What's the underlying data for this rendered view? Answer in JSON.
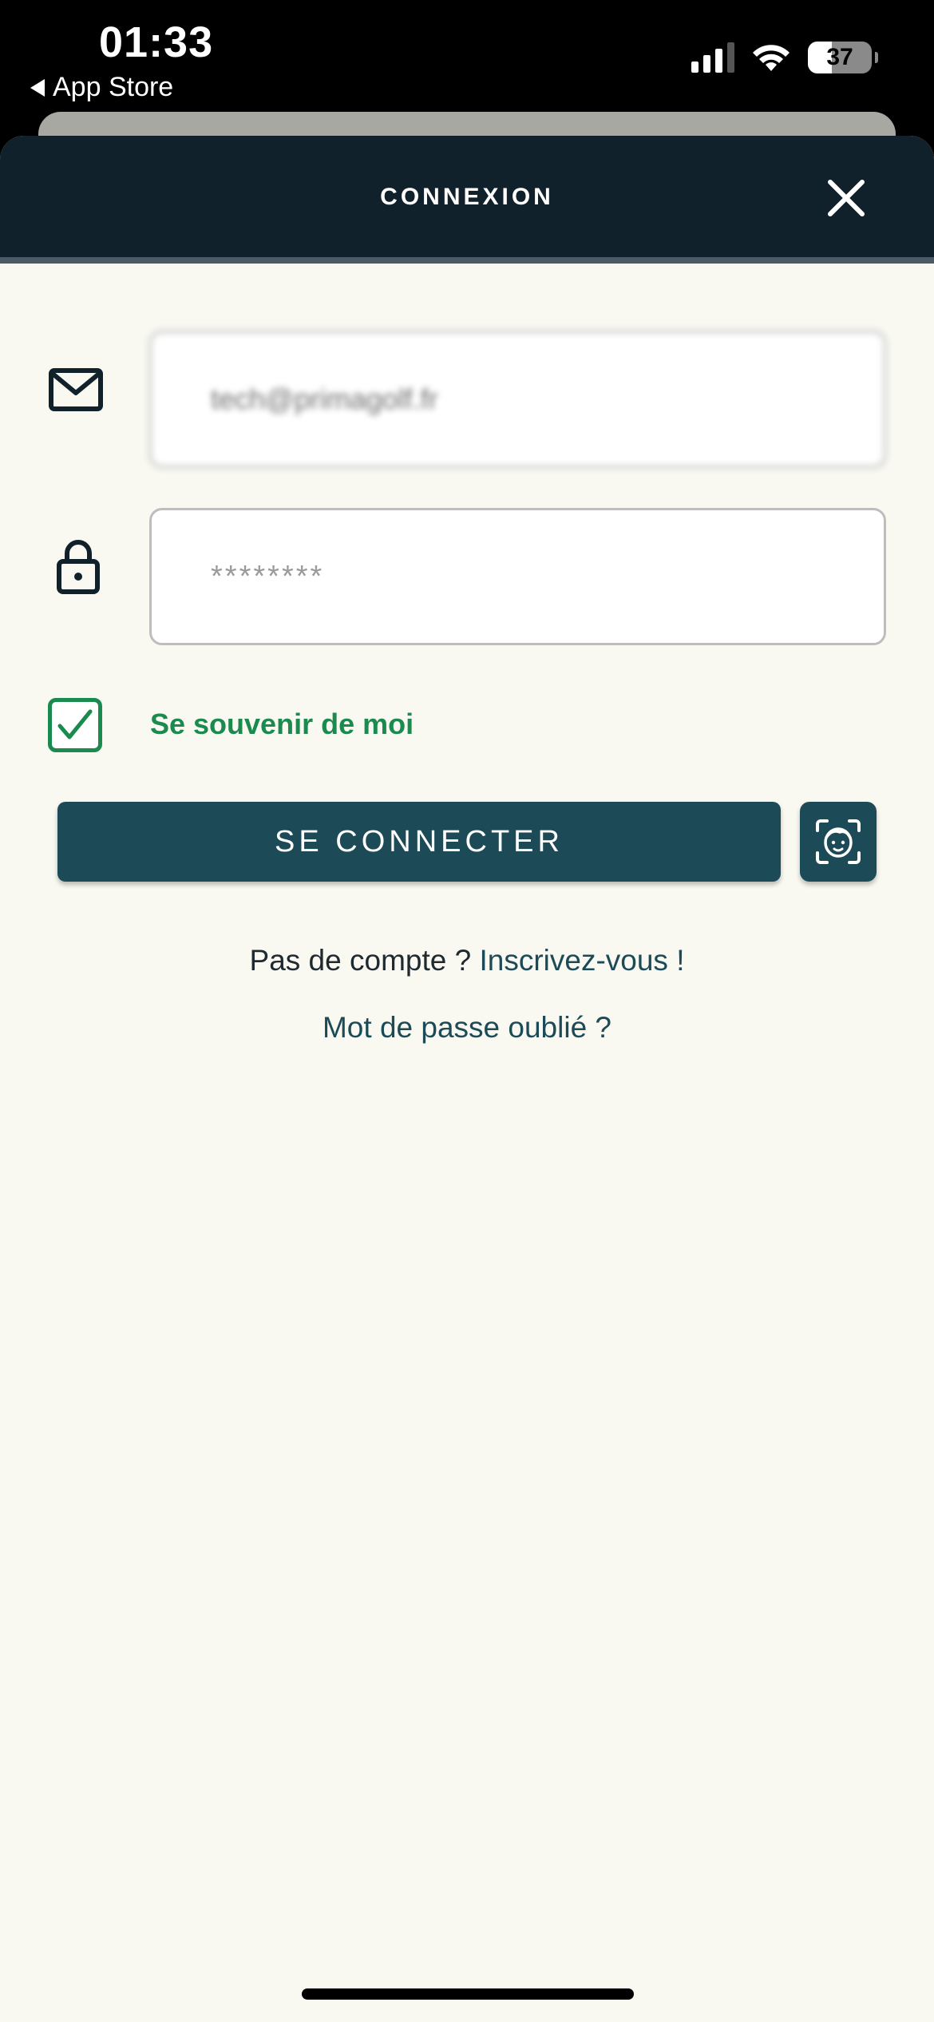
{
  "status_bar": {
    "time": "01:33",
    "back_label": "App Store",
    "battery_percent": "37"
  },
  "modal": {
    "title": "CONNEXION",
    "close_icon": "close-icon"
  },
  "form": {
    "email_value": "tech@primagolf.fr",
    "email_icon": "mail-icon",
    "password_value": "********",
    "password_icon": "lock-icon",
    "remember_checked": true,
    "remember_label": "Se souvenir de moi",
    "login_label": "SE CONNECTER",
    "faceid_icon": "face-id-icon"
  },
  "links": {
    "no_account_text": "Pas de compte ?",
    "signup_link": "Inscrivez-vous !",
    "forgot_password": "Mot de passe oublié ?"
  },
  "colors": {
    "header_bg": "#10212b",
    "primary": "#1c4b57",
    "success_green": "#1b8a4e",
    "page_bg": "#f9f9f2"
  }
}
